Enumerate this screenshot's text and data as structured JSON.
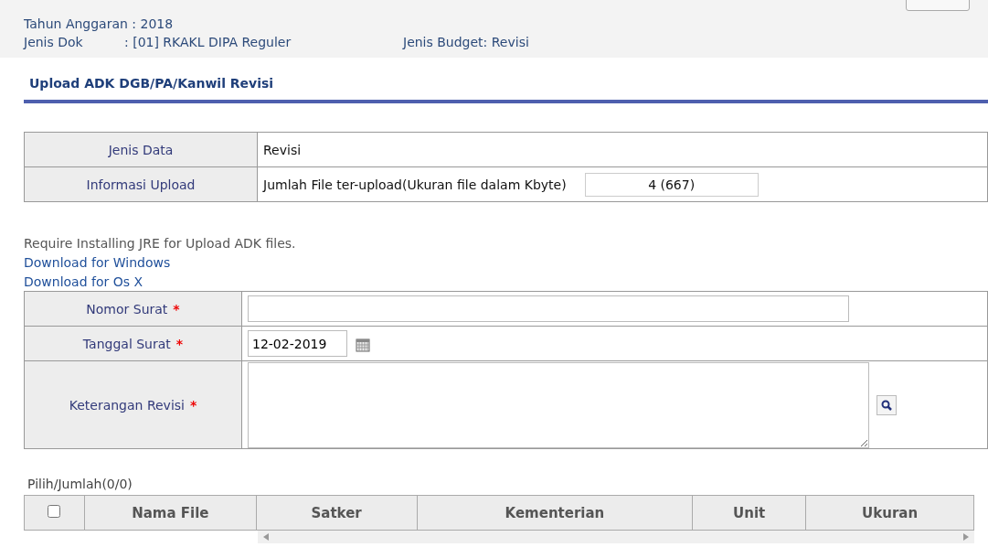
{
  "header": {
    "lines": [
      {
        "label": "Tahun Anggaran : 2018"
      },
      {
        "label": "Jenis Dok",
        "value": ": [01] RKAKL DIPA Reguler",
        "extra": "Jenis Budget: Revisi"
      }
    ]
  },
  "page_title": "Upload ADK DGB/PA/Kanwil Revisi",
  "info_table": [
    {
      "label": "Jenis Data",
      "kind": "text",
      "value": "Revisi"
    },
    {
      "label": "Informasi Upload",
      "kind": "count",
      "value": "Jumlah File ter-upload(Ukuran file dalam Kbyte)",
      "count": "4   (667)"
    }
  ],
  "notice": "Require Installing JRE for Upload ADK files.",
  "links": [
    "Download for Windows",
    "Download for Os X"
  ],
  "required_mark": "*",
  "form": [
    {
      "label": "Nomor Surat",
      "required": true,
      "kind": "input"
    },
    {
      "label": "Tanggal Surat",
      "required": true,
      "kind": "date",
      "value": "12-02-2019"
    },
    {
      "label": "Keterangan Revisi",
      "required": true,
      "kind": "textarea"
    }
  ],
  "file_table": {
    "caption": "Pilih/Jumlah(0/0)",
    "select_all_checked": false,
    "columns": [
      "Nama File",
      "Satker",
      "Kementerian",
      "Unit",
      "Ukuran"
    ]
  }
}
